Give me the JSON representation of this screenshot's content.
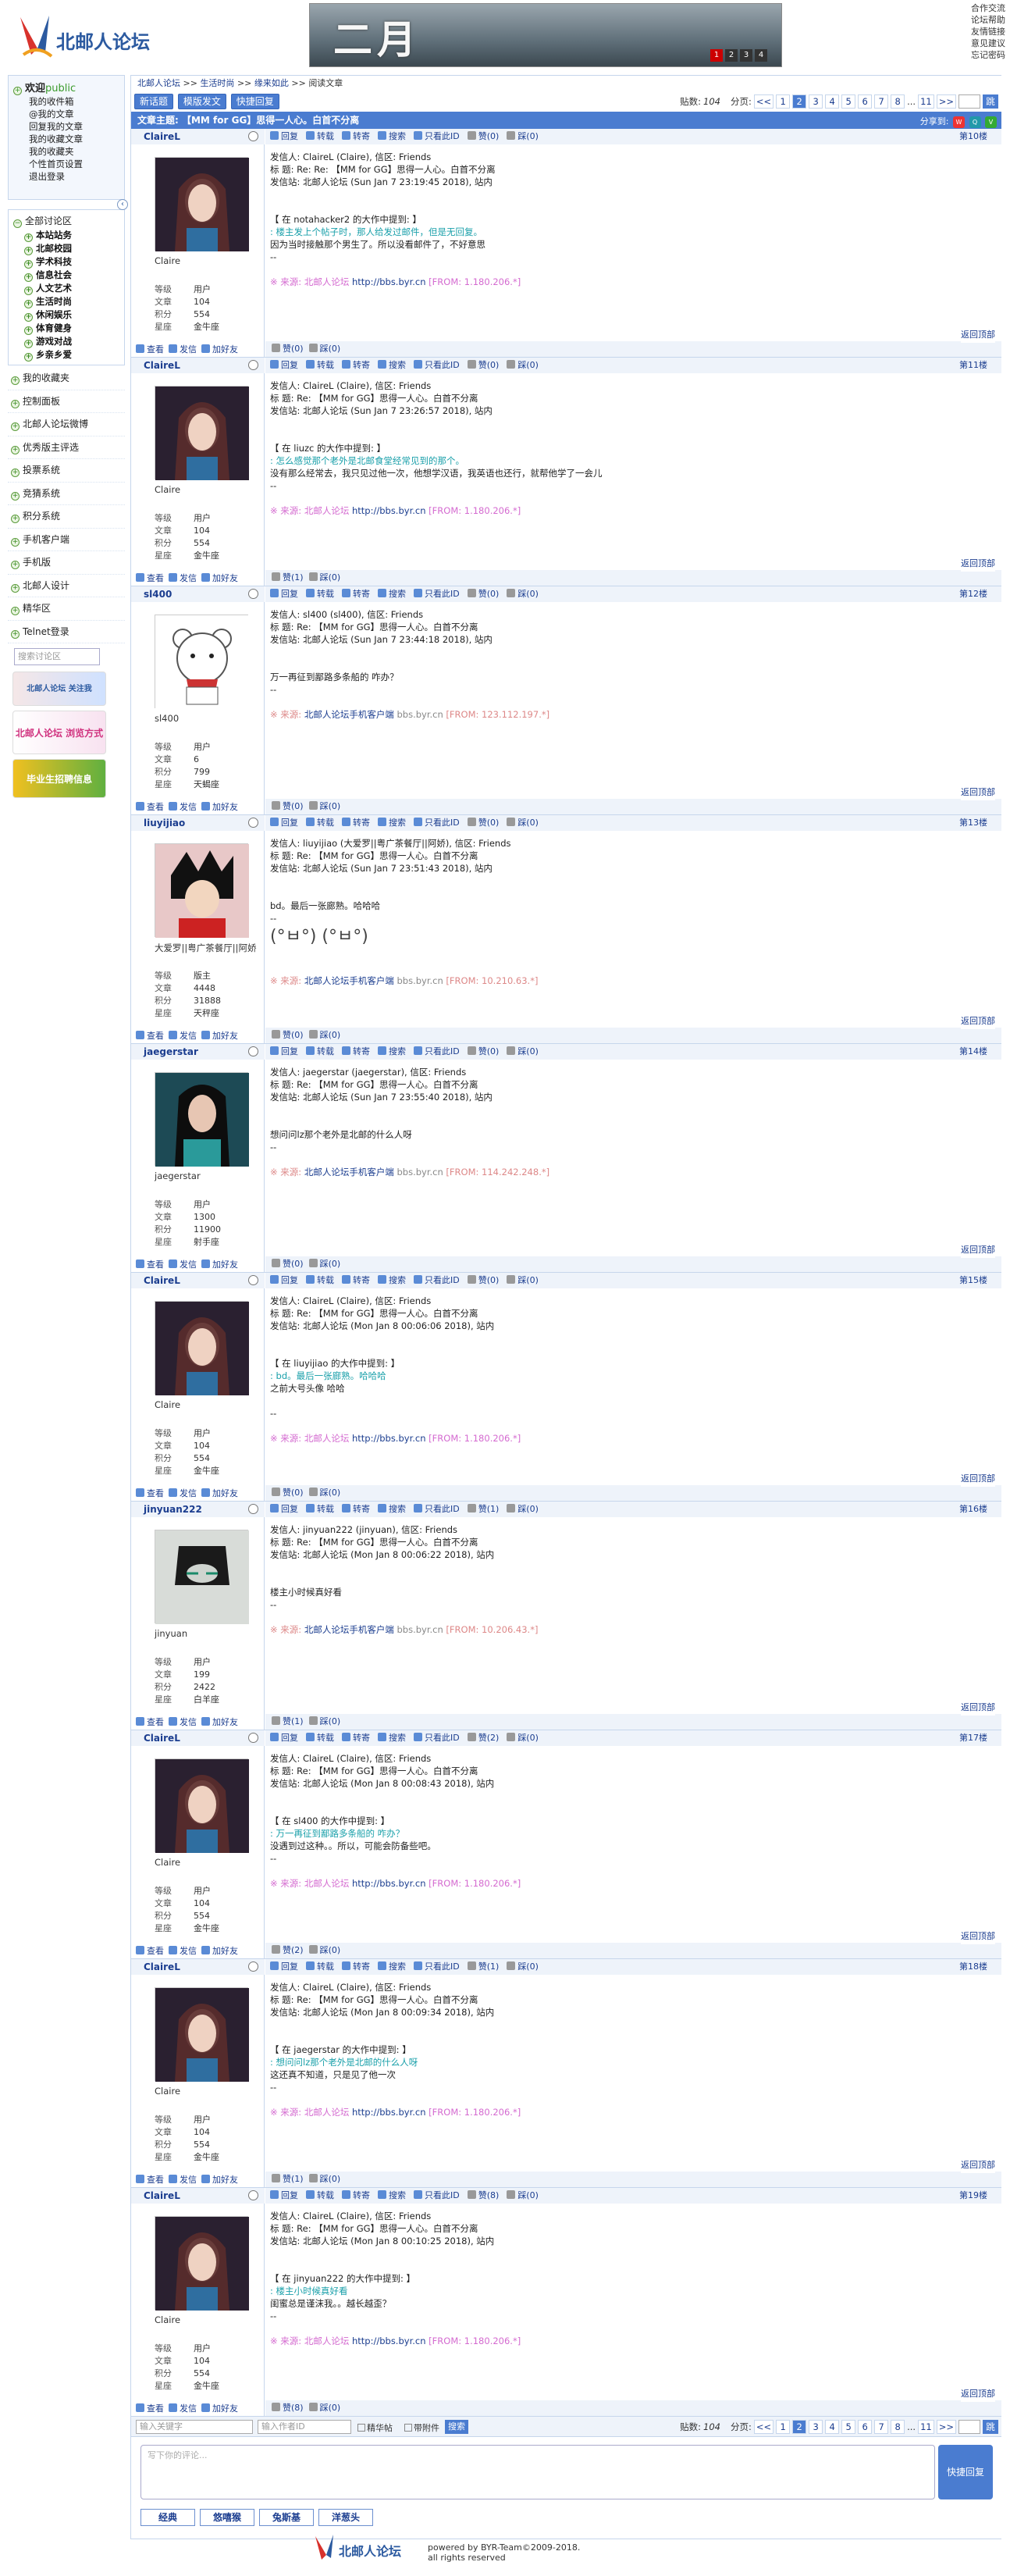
{
  "header": {
    "site_name": "北邮人论坛",
    "banner_text": "二月",
    "banner_pages": [
      "1",
      "2",
      "3",
      "4"
    ],
    "top_links": [
      "合作交流",
      "论坛帮助",
      "友情链接",
      "意见建议",
      "忘记密码"
    ]
  },
  "sidebar": {
    "welcome": "欢迎",
    "user": "public",
    "user_links": [
      "我的收件箱",
      "@我的文章",
      "回复我的文章",
      "我的收藏文章",
      "我的收藏夹",
      "个性首页设置",
      "退出登录"
    ],
    "all_sections": "全部讨论区",
    "sections": [
      "本站站务",
      "北邮校园",
      "学术科技",
      "信息社会",
      "人文艺术",
      "生活时尚",
      "休闲娱乐",
      "体育健身",
      "游戏对战",
      "乡亲乡爱"
    ],
    "nav": [
      "我的收藏夹",
      "控制面板",
      "北邮人论坛微博",
      "优秀版主评选",
      "投票系统",
      "竞猜系统",
      "积分系统",
      "手机客户端",
      "手机版",
      "北邮人设计",
      "精华区",
      "Telnet登录"
    ],
    "search_placeholder": "搜索讨论区",
    "promos": [
      "北邮人论坛 关注我",
      "北邮人论坛 浏览方式",
      "毕业生招聘信息"
    ]
  },
  "main": {
    "breadcrumb": [
      "北邮人论坛",
      ">>",
      "生活时尚",
      ">>",
      "缘来如此",
      ">>",
      "阅读文章"
    ],
    "buttons": [
      "新话题",
      "模版发文",
      "快捷回复"
    ],
    "pager": {
      "count_label": "贴数:",
      "count": "104",
      "label": "分页:",
      "prev": "<<",
      "pages": [
        "1",
        "2",
        "3",
        "4",
        "5",
        "6",
        "7",
        "8",
        "...",
        "11"
      ],
      "next": ">>",
      "current": "2",
      "go": "跳"
    },
    "topic_title": "文章主题: 【MM for GG】思得一人心。白首不分离",
    "share_label": "分享到:",
    "tool_actions": [
      "回复",
      "转载",
      "转寄",
      "搜索",
      "只看此ID",
      "赞(0)",
      "踩(0)"
    ],
    "foot_actions": [
      "查看",
      "发信",
      "加好友"
    ],
    "back_top": "返回顶部"
  },
  "posts": [
    {
      "id": "ClaireL",
      "nick": "Claire",
      "role": "用户",
      "articles": "104",
      "score": "554",
      "star": "金牛座",
      "floor": "第10楼",
      "avatar": "claire",
      "lines": [
        "发信人: ClaireL (Claire), 信区: Friends",
        "标 题: Re: Re: 【MM for GG】思得一人心。白首不分离",
        "发信站: 北邮人论坛 (Sun Jan 7 23:19:45 2018), 站内"
      ],
      "quote_head": "【 在 notahacker2 的大作中提到: 】",
      "quote": ": 楼主发上个帖子时，那人给发过邮件，但是无回复。",
      "text": [
        "因为当时接触那个男生了。所以没看邮件了，不好意思",
        "--"
      ],
      "src": "※ 来源: 北邮人论坛 http://bbs.byr.cn [FROM: 1.180.206.*]",
      "mobile": false,
      "zan": "赞(0)",
      "cai": "踩(0)",
      "fzan": "赞(0)",
      "fcai": "踩(0)"
    },
    {
      "id": "ClaireL",
      "nick": "Claire",
      "role": "用户",
      "articles": "104",
      "score": "554",
      "star": "金牛座",
      "floor": "第11楼",
      "avatar": "claire",
      "lines": [
        "发信人: ClaireL (Claire), 信区: Friends",
        "标 题: Re: 【MM for GG】思得一人心。白首不分离",
        "发信站: 北邮人论坛 (Sun Jan 7 23:26:57 2018), 站内"
      ],
      "quote_head": "【 在 liuzc 的大作中提到: 】",
      "quote": ": 怎么感觉那个老外是北邮食堂经常见到的那个。",
      "text": [
        "没有那么经常去，我只见过他一次，他想学汉语，我英语也还行，就帮他学了一会儿",
        "--"
      ],
      "src": "※ 来源: 北邮人论坛 http://bbs.byr.cn [FROM: 1.180.206.*]",
      "mobile": false,
      "zan": "赞(0)",
      "cai": "踩(0)",
      "fzan": "赞(1)",
      "fcai": "踩(0)"
    },
    {
      "id": "sl400",
      "nick": "sl400",
      "role": "用户",
      "articles": "6",
      "score": "799",
      "star": "天蝎座",
      "floor": "第12楼",
      "avatar": "bear",
      "lines": [
        "发信人: sl400 (sl400), 信区: Friends",
        "标 题: Re: 【MM for GG】思得一人心。白首不分离",
        "发信站: 北邮人论坛 (Sun Jan 7 23:44:18 2018), 站内"
      ],
      "quote_head": "",
      "quote": "",
      "text": [
        "万一再征到鄙路多条船的 咋办？",
        "--"
      ],
      "src": "※ 来源: 北邮人论坛手机客户端 bbs.byr.cn [FROM: 123.112.197.*]",
      "mobile": true,
      "zan": "赞(0)",
      "cai": "踩(0)",
      "fzan": "赞(0)",
      "fcai": "踩(0)"
    },
    {
      "id": "liuyijiao",
      "nick": "大爱罗||粤广茶餐厅||阿娇",
      "role": "版主",
      "articles": "4448",
      "score": "31888",
      "star": "天秤座",
      "floor": "第13楼",
      "avatar": "anime",
      "lines": [
        "发信人: liuyijiao (大爱罗||粤广茶餐厅||阿娇), 信区: Friends",
        "标 题: Re: 【MM for GG】思得一人心。白首不分离",
        "发信站: 北邮人论坛 (Sun Jan 7 23:51:43 2018), 站内"
      ],
      "quote_head": "",
      "quote": "",
      "text": [
        "bd。最后一张廊熟。哈哈哈",
        "--"
      ],
      "src": "※ 来源: 北邮人论坛手机客户端 bbs.byr.cn [FROM: 10.210.63.*]",
      "mobile": true,
      "emoji": true,
      "zan": "赞(0)",
      "cai": "踩(0)",
      "fzan": "赞(0)",
      "fcai": "踩(0)"
    },
    {
      "id": "jaegerstar",
      "nick": "jaegerstar",
      "role": "用户",
      "articles": "1300",
      "score": "11900",
      "star": "射手座",
      "floor": "第14楼",
      "avatar": "girl",
      "lines": [
        "发信人: jaegerstar (jaegerstar), 信区: Friends",
        "标 题: Re: 【MM for GG】思得一人心。白首不分离",
        "发信站: 北邮人论坛 (Sun Jan 7 23:55:40 2018), 站内"
      ],
      "quote_head": "",
      "quote": "",
      "text": [
        "想问问lz那个老外是北邮的什么人呀",
        "--"
      ],
      "src": "※ 来源: 北邮人论坛手机客户端 bbs.byr.cn [FROM: 114.242.248.*]",
      "mobile": true,
      "zan": "赞(0)",
      "cai": "踩(0)",
      "fzan": "赞(0)",
      "fcai": "踩(0)"
    },
    {
      "id": "ClaireL",
      "nick": "Claire",
      "role": "用户",
      "articles": "104",
      "score": "554",
      "star": "金牛座",
      "floor": "第15楼",
      "avatar": "claire",
      "lines": [
        "发信人: ClaireL (Claire), 信区: Friends",
        "标 题: Re: 【MM for GG】思得一人心。白首不分离",
        "发信站: 北邮人论坛 (Mon Jan 8 00:06:06 2018), 站内"
      ],
      "quote_head": "【 在 liuyijiao 的大作中提到: 】",
      "quote": ": bd。最后一张廊熟。哈哈哈",
      "text": [
        "之前大号头像 哈哈",
        "",
        "--"
      ],
      "src": "※ 来源: 北邮人论坛 http://bbs.byr.cn [FROM: 1.180.206.*]",
      "mobile": false,
      "zan": "赞(0)",
      "cai": "踩(0)",
      "fzan": "赞(0)",
      "fcai": "踩(0)"
    },
    {
      "id": "jinyuan222",
      "nick": "jinyuan",
      "role": "用户",
      "articles": "199",
      "score": "2422",
      "star": "白羊座",
      "floor": "第16楼",
      "avatar": "dark",
      "lines": [
        "发信人: jinyuan222 (jinyuan), 信区: Friends",
        "标 题: Re: 【MM for GG】思得一人心。白首不分离",
        "发信站: 北邮人论坛 (Mon Jan 8 00:06:22 2018), 站内"
      ],
      "quote_head": "",
      "quote": "",
      "text": [
        "楼主小时候真好看",
        "--"
      ],
      "src": "※ 来源: 北邮人论坛手机客户端 bbs.byr.cn [FROM: 10.206.43.*]",
      "mobile": true,
      "zan": "赞(1)",
      "cai": "踩(0)",
      "fzan": "赞(1)",
      "fcai": "踩(0)"
    },
    {
      "id": "ClaireL",
      "nick": "Claire",
      "role": "用户",
      "articles": "104",
      "score": "554",
      "star": "金牛座",
      "floor": "第17楼",
      "avatar": "claire",
      "lines": [
        "发信人: ClaireL (Claire), 信区: Friends",
        "标 题: Re: 【MM for GG】思得一人心。白首不分离",
        "发信站: 北邮人论坛 (Mon Jan 8 00:08:43 2018), 站内"
      ],
      "quote_head": "【 在 sl400 的大作中提到: 】",
      "quote": ": 万一再征到鄙路多条船的 咋办？",
      "text": [
        "没遇到过这种。。所以，可能会防备些吧。",
        "--"
      ],
      "src": "※ 来源: 北邮人论坛 http://bbs.byr.cn [FROM: 1.180.206.*]",
      "mobile": false,
      "zan": "赞(2)",
      "cai": "踩(0)",
      "fzan": "赞(2)",
      "fcai": "踩(0)"
    },
    {
      "id": "ClaireL",
      "nick": "Claire",
      "role": "用户",
      "articles": "104",
      "score": "554",
      "star": "金牛座",
      "floor": "第18楼",
      "avatar": "claire",
      "lines": [
        "发信人: ClaireL (Claire), 信区: Friends",
        "标 题: Re: 【MM for GG】思得一人心。白首不分离",
        "发信站: 北邮人论坛 (Mon Jan 8 00:09:34 2018), 站内"
      ],
      "quote_head": "【 在 jaegerstar 的大作中提到: 】",
      "quote": ": 想问问lz那个老外是北邮的什么人呀",
      "text": [
        "这还真不知道，只是见了他一次",
        "--"
      ],
      "src": "※ 来源: 北邮人论坛 http://bbs.byr.cn [FROM: 1.180.206.*]",
      "mobile": false,
      "zan": "赞(1)",
      "cai": "踩(0)",
      "fzan": "赞(1)",
      "fcai": "踩(0)"
    },
    {
      "id": "ClaireL",
      "nick": "Claire",
      "role": "用户",
      "articles": "104",
      "score": "554",
      "star": "金牛座",
      "floor": "第19楼",
      "avatar": "claire",
      "lines": [
        "发信人: ClaireL (Claire), 信区: Friends",
        "标 题: Re: 【MM for GG】思得一人心。白首不分离",
        "发信站: 北邮人论坛 (Mon Jan 8 00:10:25 2018), 站内"
      ],
      "quote_head": "【 在 jinyuan222 的大作中提到: 】",
      "quote": ": 楼主小时候真好看",
      "text": [
        "闺蜜总是谨沫我。。越长越歪？",
        "--"
      ],
      "src": "※ 来源: 北邮人论坛 http://bbs.byr.cn [FROM: 1.180.206.*]",
      "mobile": false,
      "zan": "赞(8)",
      "cai": "踩(0)",
      "fzan": "赞(8)",
      "fcai": "踩(0)"
    }
  ],
  "bottom": {
    "kw_placeholder": "输入关键字",
    "author_placeholder": "输入作者ID",
    "check1": "精华帖",
    "check2": "带附件",
    "search_btn": "搜索"
  },
  "reply": {
    "placeholder": "写下你的评论...",
    "button": "快捷回复",
    "emojis": [
      "经典",
      "悠嘻猴",
      "兔斯基",
      "洋葱头"
    ]
  },
  "footer": {
    "line1": "powered by BYR-Team©2009-2018.",
    "line2": "all rights reserved"
  }
}
